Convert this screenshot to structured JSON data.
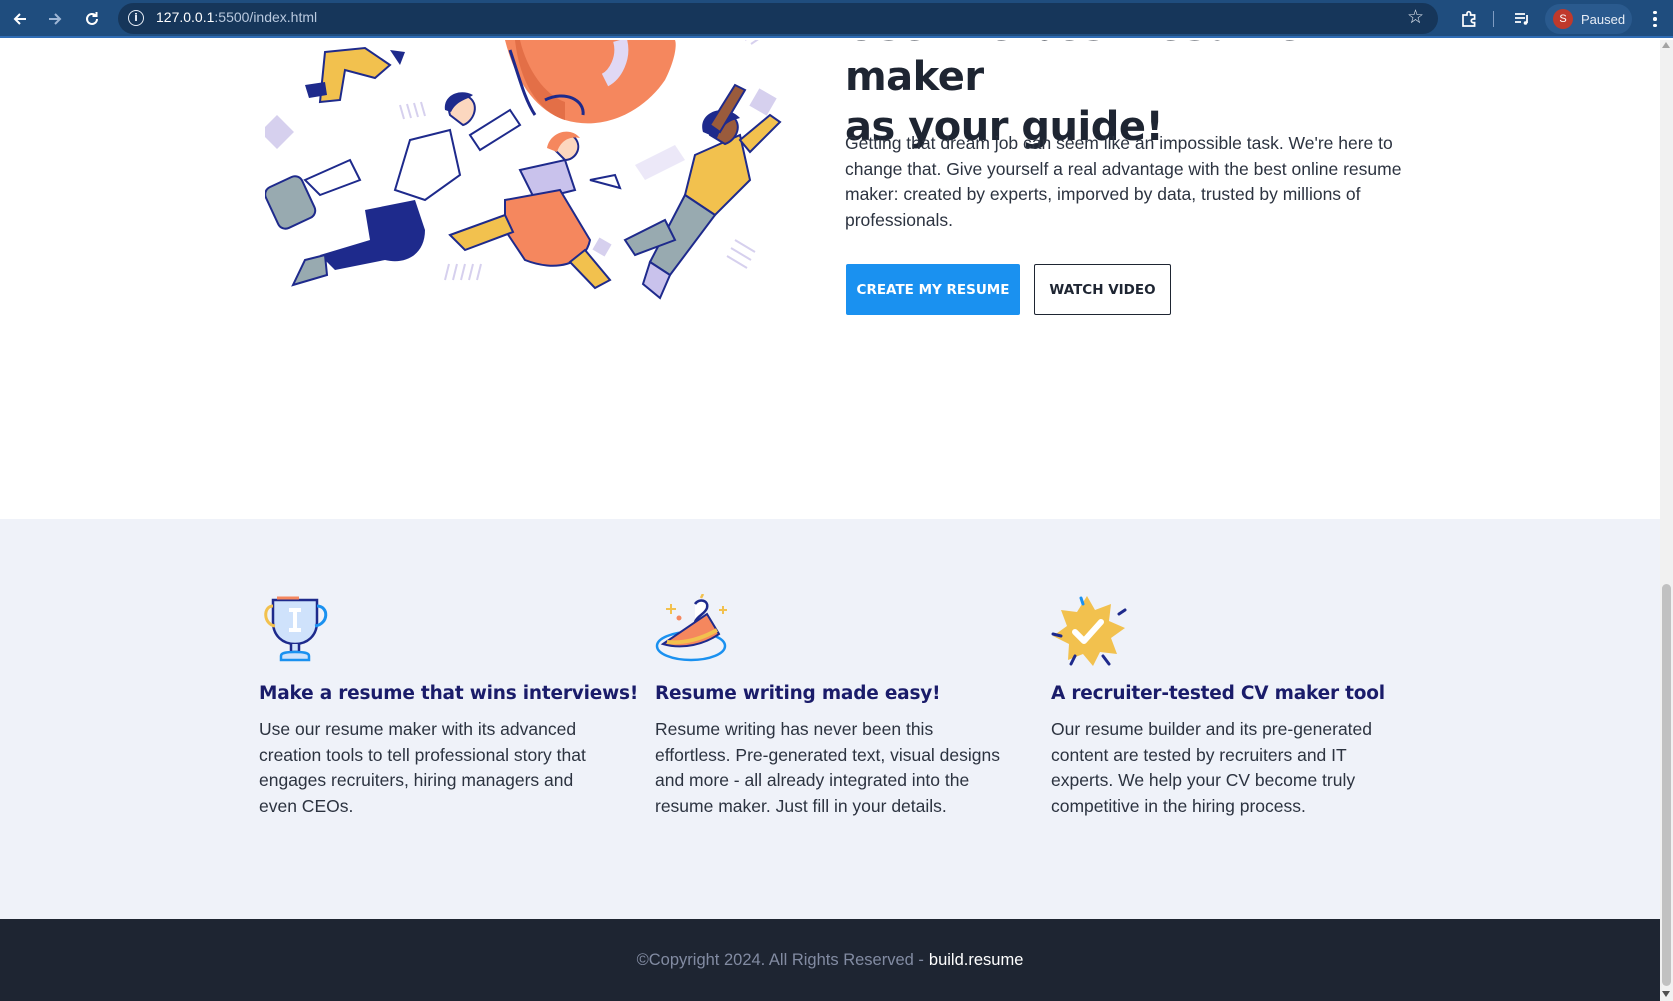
{
  "browser": {
    "url_host": "127.0.0.1",
    "url_rest": ":5500/index.html",
    "profile_initial": "S",
    "profile_status": "Paused"
  },
  "hero": {
    "title_line1": "Use the best resume maker",
    "title_line2": "as your guide!",
    "description": "Getting that dream job can seem like an impossible task. We're here to change that. Give yourself a real advantage with the best online resume maker: created by experts, imporved by data, trusted by millions of professionals.",
    "primary_button": "CREATE MY RESUME",
    "secondary_button": "WATCH VIDEO"
  },
  "features": [
    {
      "icon": "trophy-icon",
      "title": "Make a resume that wins interviews!",
      "text": "Use our resume maker with its advanced creation tools to tell professional story that engages recruiters, hiring managers and even CEOs."
    },
    {
      "icon": "cake-slice-icon",
      "title": "Resume writing made easy!",
      "text": "Resume writing has never been this effortless. Pre-generated text, visual designs and more - all already integrated into the resume maker. Just fill in your details."
    },
    {
      "icon": "verified-badge-icon",
      "title": "A recruiter-tested CV maker tool",
      "text": "Our resume builder and its pre-generated content are tested by recruiters and IT experts. We help your CV become truly competitive in the hiring process."
    }
  ],
  "footer": {
    "copyright": "©Copyright 2024. All Rights Reserved -",
    "brand": "build.resume"
  },
  "colors": {
    "chrome_bg": "#1f4d7e",
    "primary": "#1a91f0",
    "heading_dark": "#1e2532",
    "feature_title": "#1a1c6a",
    "features_bg": "#eff2f9",
    "footer_bg": "#1e2532"
  }
}
